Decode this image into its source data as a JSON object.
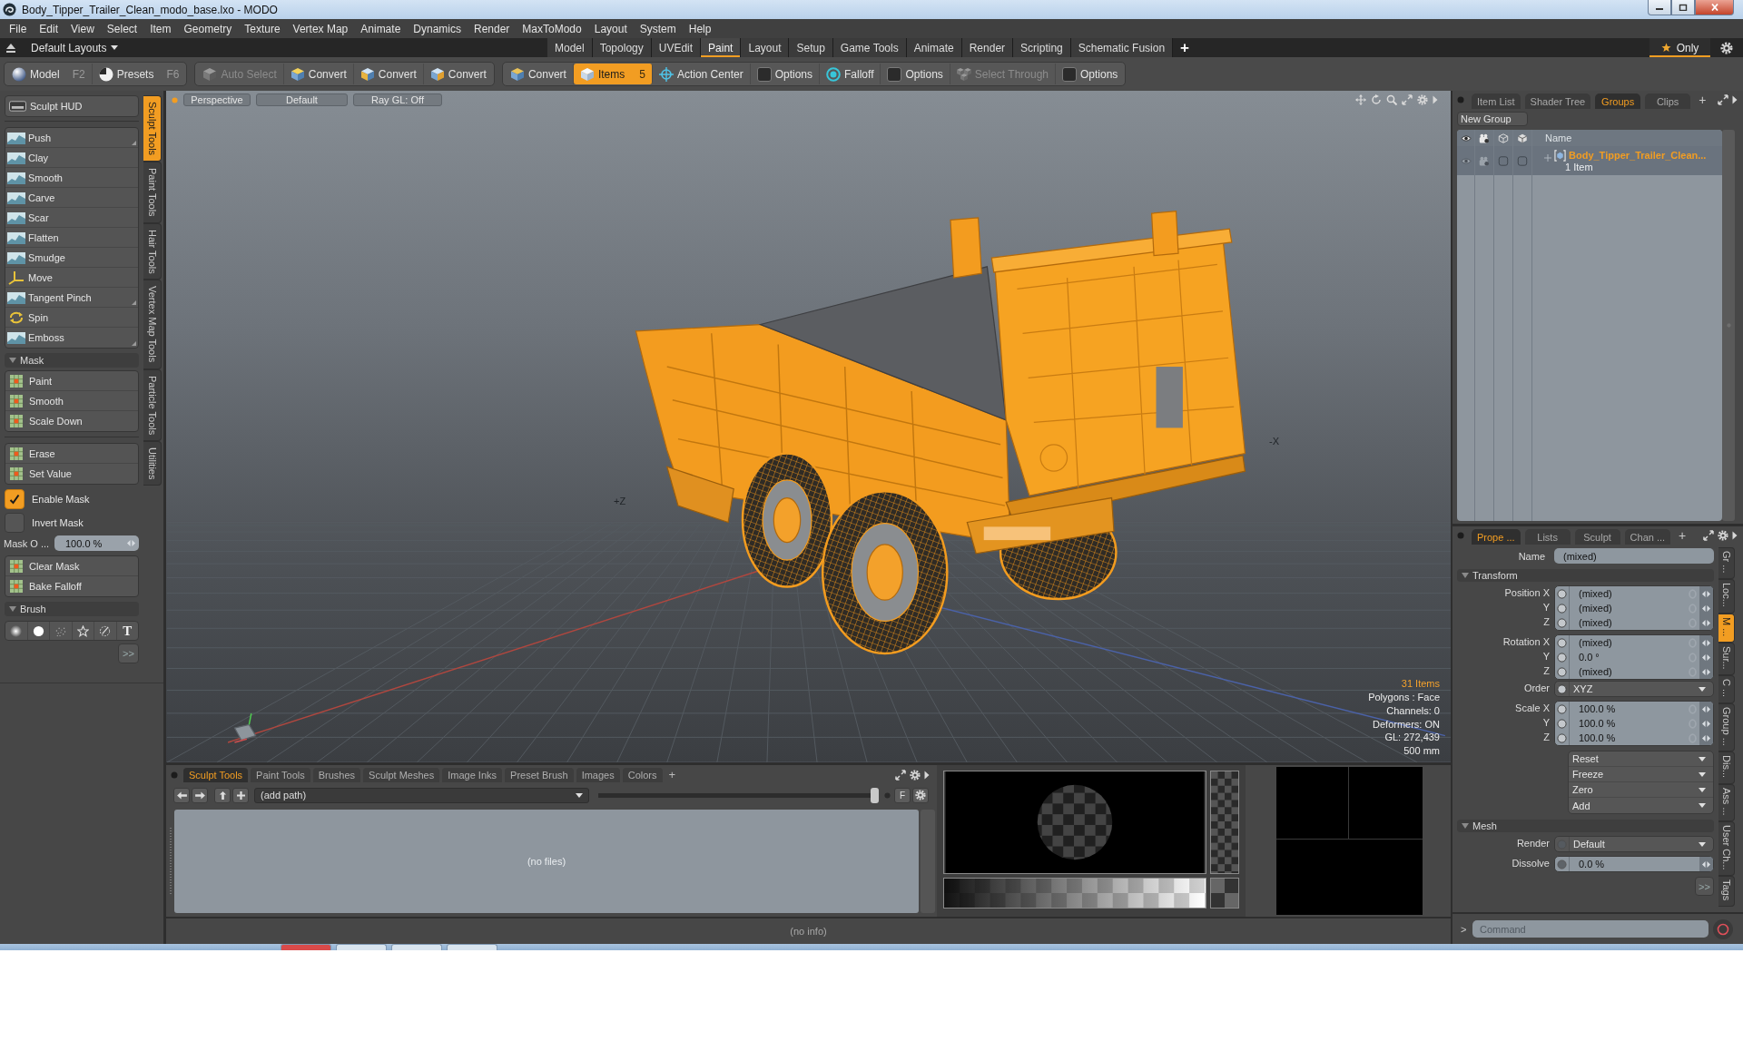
{
  "window": {
    "title": "Body_Tipper_Trailer_Clean_modo_base.lxo - MODO"
  },
  "menu": [
    "File",
    "Edit",
    "View",
    "Select",
    "Item",
    "Geometry",
    "Texture",
    "Vertex Map",
    "Animate",
    "Dynamics",
    "Render",
    "MaxToModo",
    "Layout",
    "System",
    "Help"
  ],
  "layout_bar": {
    "layouts_menu": "Default Layouts",
    "tabs": [
      {
        "label": "Model",
        "selected": false
      },
      {
        "label": "Topology",
        "selected": false
      },
      {
        "label": "UVEdit",
        "selected": false
      },
      {
        "label": "Paint",
        "selected": true
      },
      {
        "label": "Layout",
        "selected": false
      },
      {
        "label": "Setup",
        "selected": false
      },
      {
        "label": "Game Tools",
        "selected": false
      },
      {
        "label": "Animate",
        "selected": false
      },
      {
        "label": "Render",
        "selected": false
      },
      {
        "label": "Scripting",
        "selected": false
      },
      {
        "label": "Schematic Fusion",
        "selected": false
      }
    ],
    "add_tab": "+",
    "only_button": "Only"
  },
  "toolbar": {
    "groups": [
      {
        "items": [
          {
            "label": "Model",
            "shortcut": "F2",
            "selected": false,
            "disabled": false
          },
          {
            "label": "Presets",
            "shortcut": "F6",
            "selected": false,
            "disabled": false
          }
        ]
      },
      {
        "items": [
          {
            "label": "Auto Select",
            "selected": false,
            "disabled": true
          },
          {
            "label": "Convert",
            "selected": false,
            "disabled": false
          },
          {
            "label": "Convert",
            "selected": false,
            "disabled": false
          },
          {
            "label": "Convert",
            "selected": false,
            "disabled": false
          }
        ]
      },
      {
        "items": [
          {
            "label": "Convert",
            "selected": false,
            "disabled": false
          },
          {
            "label": "Items",
            "badge": "5",
            "selected": true,
            "disabled": false
          },
          {
            "label": "Action Center",
            "selected": false,
            "disabled": false
          },
          {
            "label": "Options",
            "selected": false,
            "disabled": false
          },
          {
            "label": "Falloff",
            "selected": false,
            "disabled": false
          },
          {
            "label": "Options",
            "selected": false,
            "disabled": false
          },
          {
            "label": "Select Through",
            "selected": false,
            "disabled": true
          },
          {
            "label": "Options",
            "selected": false,
            "disabled": false
          }
        ]
      }
    ]
  },
  "left_panel": {
    "hud_button": "Sculpt HUD",
    "tools": [
      {
        "label": "Push",
        "submenu": true
      },
      {
        "label": "Clay",
        "submenu": false
      },
      {
        "label": "Smooth",
        "submenu": false
      },
      {
        "label": "Carve",
        "submenu": false
      },
      {
        "label": "Scar",
        "submenu": false
      },
      {
        "label": "Flatten",
        "submenu": false
      },
      {
        "label": "Smudge",
        "submenu": false
      },
      {
        "label": "Move",
        "submenu": false
      },
      {
        "label": "Tangent Pinch",
        "submenu": true
      },
      {
        "label": "Spin",
        "submenu": false
      },
      {
        "label": "Emboss",
        "submenu": true
      }
    ],
    "mask": {
      "title": "Mask",
      "expanded": true,
      "tools": [
        "Paint",
        "Smooth",
        "Scale Down"
      ],
      "edit_tools": [
        "Erase",
        "Set Value"
      ],
      "options": [
        {
          "label": "Enable Mask",
          "checked": true
        },
        {
          "label": "Invert Mask",
          "checked": false
        }
      ],
      "opacity": {
        "label": "Mask O ...",
        "value": "100.0 %"
      },
      "actions": [
        "Clear Mask",
        "Bake Falloff"
      ]
    },
    "brush": {
      "title": "Brush",
      "expanded": true,
      "presets": [
        {
          "selected": false
        },
        {
          "selected": false
        },
        {
          "selected": false
        },
        {
          "selected": false
        },
        {
          "selected": false
        },
        {
          "label": "T",
          "selected": false
        }
      ],
      "more_button": ">>"
    },
    "tabs": [
      {
        "label": "Sculpt Tools",
        "selected": true
      },
      {
        "label": "Paint Tools",
        "selected": false
      },
      {
        "label": "Hair Tools",
        "selected": false
      },
      {
        "label": "Vertex Map Tools",
        "selected": false
      },
      {
        "label": "Particle Tools",
        "selected": false
      },
      {
        "label": "Utilities",
        "selected": false
      }
    ]
  },
  "viewport": {
    "view_buttons": [
      "Perspective",
      "Default",
      "Ray GL: Off"
    ],
    "axis_labels": [
      "+Z",
      "-X"
    ],
    "info": [
      {
        "text": "31 Items",
        "highlight": true
      },
      {
        "text": "Polygons : Face",
        "highlight": false
      },
      {
        "text": "Channels: 0",
        "highlight": false
      },
      {
        "text": "Deformers: ON",
        "highlight": false
      },
      {
        "text": "GL: 272,439",
        "highlight": false
      },
      {
        "text": "500 mm",
        "highlight": false
      }
    ]
  },
  "bottom_panel": {
    "tabs": [
      {
        "label": "Sculpt Tools",
        "selected": true
      },
      {
        "label": "Paint Tools",
        "selected": false
      },
      {
        "label": "Brushes",
        "selected": false
      },
      {
        "label": "Sculpt Meshes",
        "selected": false
      },
      {
        "label": "Image Inks",
        "selected": false
      },
      {
        "label": "Preset Brush",
        "selected": false
      },
      {
        "label": "Images",
        "selected": false
      },
      {
        "label": "Colors",
        "selected": false
      }
    ],
    "add_tab": "+",
    "path": {
      "value": "(add path)"
    },
    "thumb_size": {
      "level": 1
    },
    "filter_button": "F",
    "empty_text": "(no files)"
  },
  "status_bar": {
    "text": "(no info)"
  },
  "item_list": {
    "tabs": [
      {
        "label": "Item List",
        "selected": false
      },
      {
        "label": "Shader Tree",
        "selected": false
      },
      {
        "label": "Groups",
        "selected": true
      },
      {
        "label": "Clips",
        "selected": false
      }
    ],
    "add_tab": "+",
    "new_group_button": "New Group",
    "name_column": "Name",
    "rows": [
      {
        "name": "Body_Tipper_Trailer_Clean...",
        "count": "1 Item",
        "selected": true
      }
    ]
  },
  "properties": {
    "tabs": [
      {
        "label": "Prope ...",
        "selected": true
      },
      {
        "label": "Lists",
        "selected": false
      },
      {
        "label": "Sculpt",
        "selected": false
      },
      {
        "label": "Chan ...",
        "selected": false
      }
    ],
    "add_tab": "+",
    "name": {
      "label": "Name",
      "value": "(mixed)"
    },
    "sections": [
      {
        "title": "Transform",
        "expanded": true,
        "groups": [
          {
            "kind": "vector",
            "rows": [
              {
                "label": "Position X",
                "value": "(mixed)",
                "keyable": true
              },
              {
                "label": "Y",
                "value": "(mixed)",
                "keyable": true
              },
              {
                "label": "Z",
                "value": "(mixed)",
                "keyable": true
              }
            ]
          },
          {
            "kind": "vector",
            "rows": [
              {
                "label": "Rotation X",
                "value": "(mixed)",
                "keyable": true
              },
              {
                "label": "Y",
                "value": "0.0 °",
                "keyable": true
              },
              {
                "label": "Z",
                "value": "(mixed)",
                "keyable": true
              }
            ]
          },
          {
            "kind": "choice",
            "rows": [
              {
                "label": "Order",
                "value": "XYZ",
                "keyable": true
              }
            ]
          },
          {
            "kind": "vector",
            "rows": [
              {
                "label": "Scale X",
                "value": "100.0 %",
                "keyable": true
              },
              {
                "label": "Y",
                "value": "100.0 %",
                "keyable": true
              },
              {
                "label": "Z",
                "value": "100.0 %",
                "keyable": true
              }
            ]
          },
          {
            "kind": "actions",
            "rows": [
              {
                "value": "Reset"
              },
              {
                "value": "Freeze"
              },
              {
                "value": "Zero"
              },
              {
                "value": "Add"
              }
            ]
          }
        ]
      },
      {
        "title": "Mesh",
        "expanded": true,
        "groups": [
          {
            "kind": "choice",
            "rows": [
              {
                "label": "Render",
                "value": "Default",
                "keyable": false
              }
            ]
          },
          {
            "kind": "scalar",
            "rows": [
              {
                "label": "Dissolve",
                "value": "0.0 %",
                "keyable": false
              }
            ]
          }
        ]
      }
    ],
    "more_button": ">>",
    "side_tabs": [
      {
        "label": "Gr ...",
        "selected": false
      },
      {
        "label": "Loc...",
        "selected": false
      },
      {
        "label": "M ...",
        "selected": true
      },
      {
        "label": "Sur...",
        "selected": false
      },
      {
        "label": "C ...",
        "selected": false
      },
      {
        "label": "Group ...",
        "selected": false
      },
      {
        "label": "Dis...",
        "selected": false
      },
      {
        "label": "Ass ...",
        "selected": false
      },
      {
        "label": "User Ch...",
        "selected": false
      },
      {
        "label": "Tags",
        "selected": false
      }
    ]
  },
  "command": {
    "prompt": ">",
    "placeholder": "Command"
  }
}
